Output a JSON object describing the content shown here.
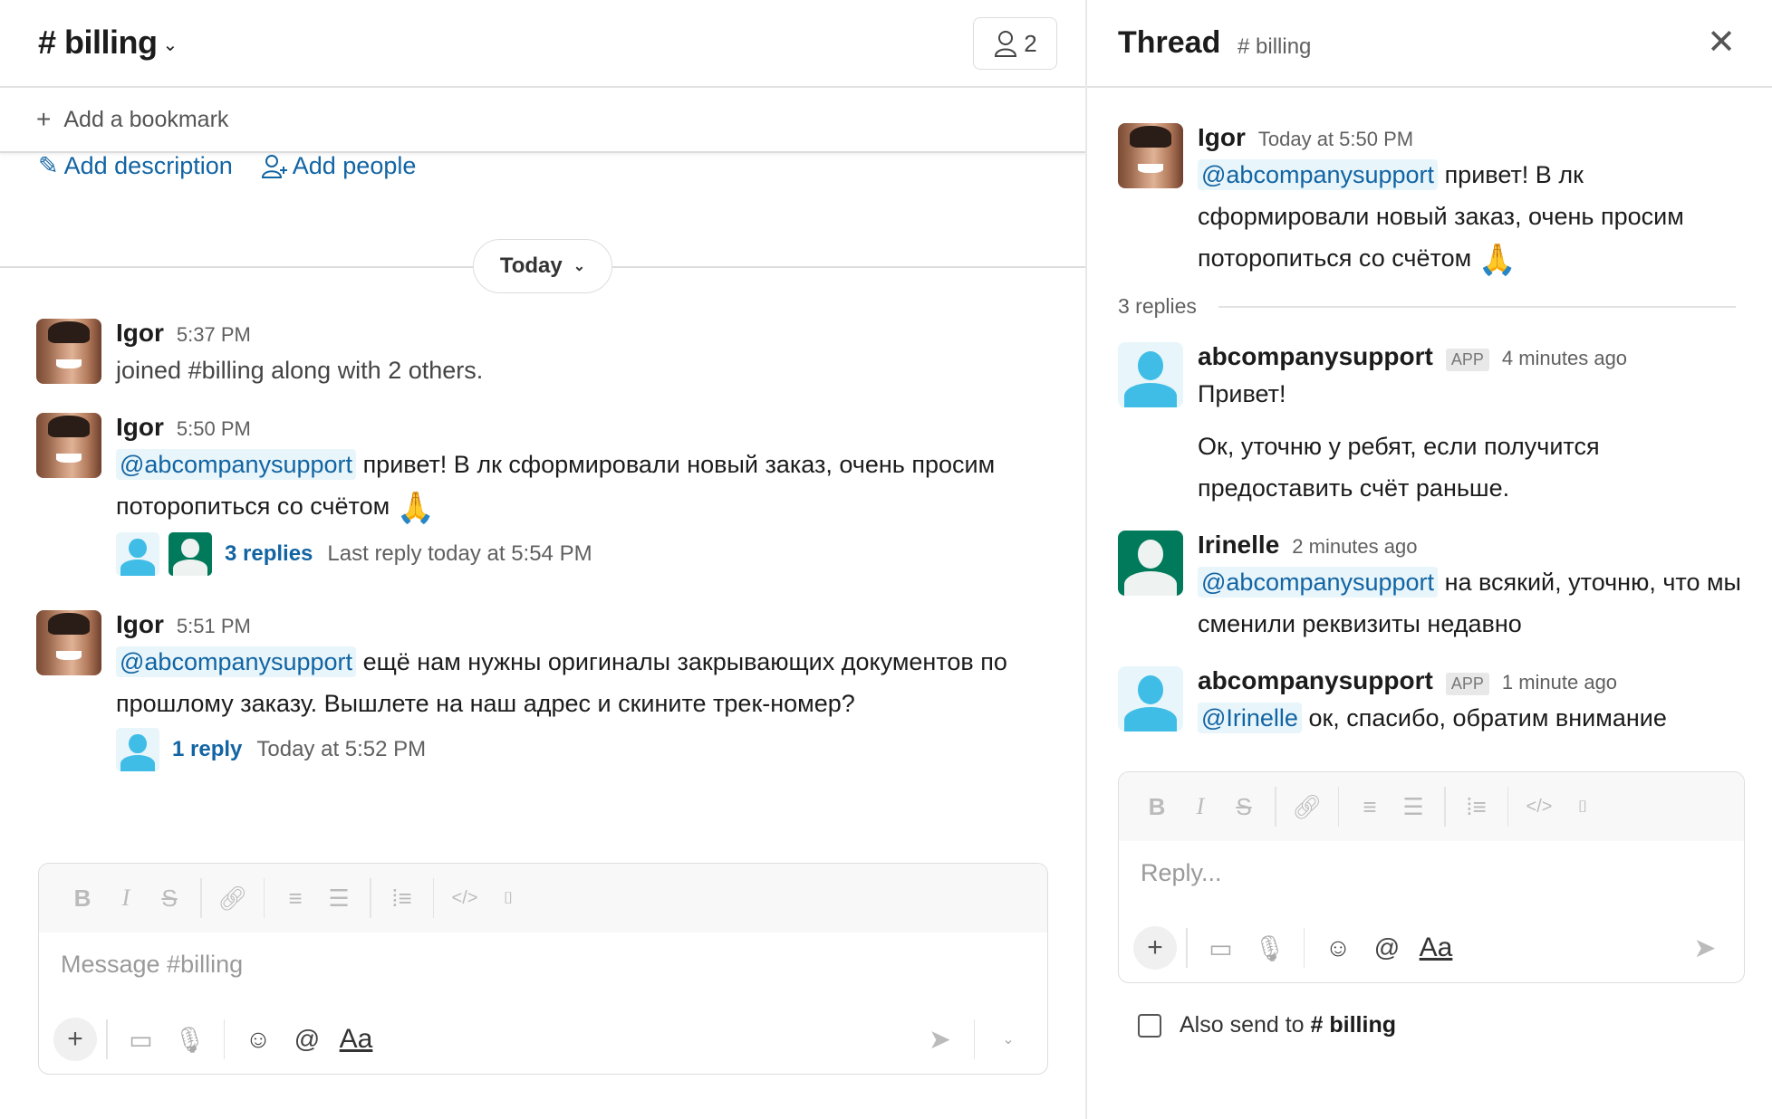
{
  "channel": {
    "name": "# billing",
    "member_count": "2",
    "bookmark_label": "Add a bookmark",
    "add_description": "Add description",
    "add_people": "Add people",
    "day_label": "Today"
  },
  "messages": [
    {
      "author": "Igor",
      "time": "5:37 PM",
      "text": "joined #billing along with 2 others."
    },
    {
      "author": "Igor",
      "time": "5:50 PM",
      "mention": "@abcompanysupport",
      "text": " привет! В лк сформировали новый заказ, очень просим поторопиться со счётом ",
      "emoji": "🙏",
      "replies_label": "3 replies",
      "last_reply": "Last reply today at 5:54 PM"
    },
    {
      "author": "Igor",
      "time": "5:51 PM",
      "mention": "@abcompanysupport",
      "text": " ещё нам нужны оригиналы закрывающих документов по прошлому заказу. Вышлете на наш адрес и скините трек-номер?",
      "replies_label": "1 reply",
      "last_reply": "Today at 5:52 PM"
    }
  ],
  "composer": {
    "placeholder": "Message #billing",
    "aa_label": "Aa"
  },
  "thread": {
    "title": "Thread",
    "channel": "# billing",
    "parent": {
      "author": "Igor",
      "time": "Today at 5:50 PM",
      "mention": "@abcompanysupport",
      "text": " привет! В лк сформировали новый заказ, очень просим поторопиться со счётом ",
      "emoji": "🙏"
    },
    "replies_count": "3 replies",
    "replies": [
      {
        "author": "abcompanysupport",
        "badge": "APP",
        "time": "4 minutes ago",
        "text": "Привет!",
        "text2": "Ок, уточню у ребят, если получится предоставить счёт раньше."
      },
      {
        "author": "Irinelle",
        "time": "2 minutes ago",
        "mention": "@abcompanysupport",
        "text": " на всякий, уточню, что мы сменили реквизиты недавно"
      },
      {
        "author": "abcompanysupport",
        "badge": "APP",
        "time": "1 minute ago",
        "mention": "@Irinelle",
        "text": " ок, спасибо, обратим внимание"
      }
    ],
    "reply_placeholder": "Reply...",
    "also_send_label": "Also send to",
    "also_send_channel": "# billing",
    "aa_label": "Aa"
  },
  "colors": {
    "link": "#1264a3",
    "mention_bg": "#e8f5fa",
    "bot_avatar": "#3fbde6",
    "green_avatar": "#007a5a"
  }
}
